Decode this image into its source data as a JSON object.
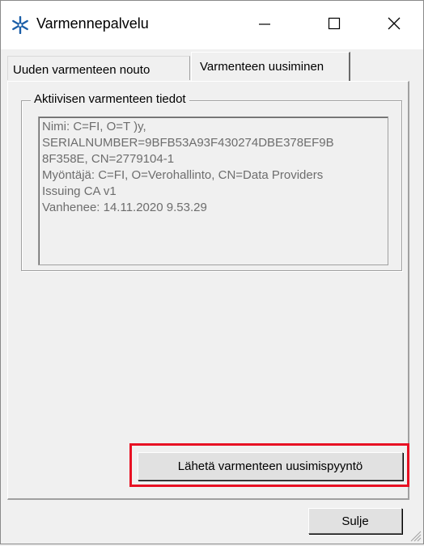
{
  "window": {
    "title": "Varmennepalvelu"
  },
  "tabs": [
    {
      "label": "Uuden varmenteen nouto",
      "selected": false
    },
    {
      "label": "Varmenteen uusiminen",
      "selected": true
    }
  ],
  "group": {
    "legend": "Aktiivisen varmenteen tiedot",
    "lines": [
      "Nimi: C=FI, O=T              )y,",
      "SERIALNUMBER=9BFB53A93F430274DBE378EF9B",
      "8F358E, CN=2779104-1",
      "Myöntäjä: C=FI, O=Verohallinto, CN=Data Providers",
      "Issuing CA v1",
      "Vanhenee: 14.11.2020 9.53.29"
    ]
  },
  "buttons": {
    "renew": "Lähetä varmenteen uusimispyyntö",
    "close": "Sulje"
  },
  "icons": {
    "app": "snowflake-icon",
    "minimize": "minimize-icon",
    "maximize": "maximize-icon",
    "close": "close-icon"
  },
  "colors": {
    "highlight": "#e81123",
    "app_icon": "#1c5fa8"
  }
}
